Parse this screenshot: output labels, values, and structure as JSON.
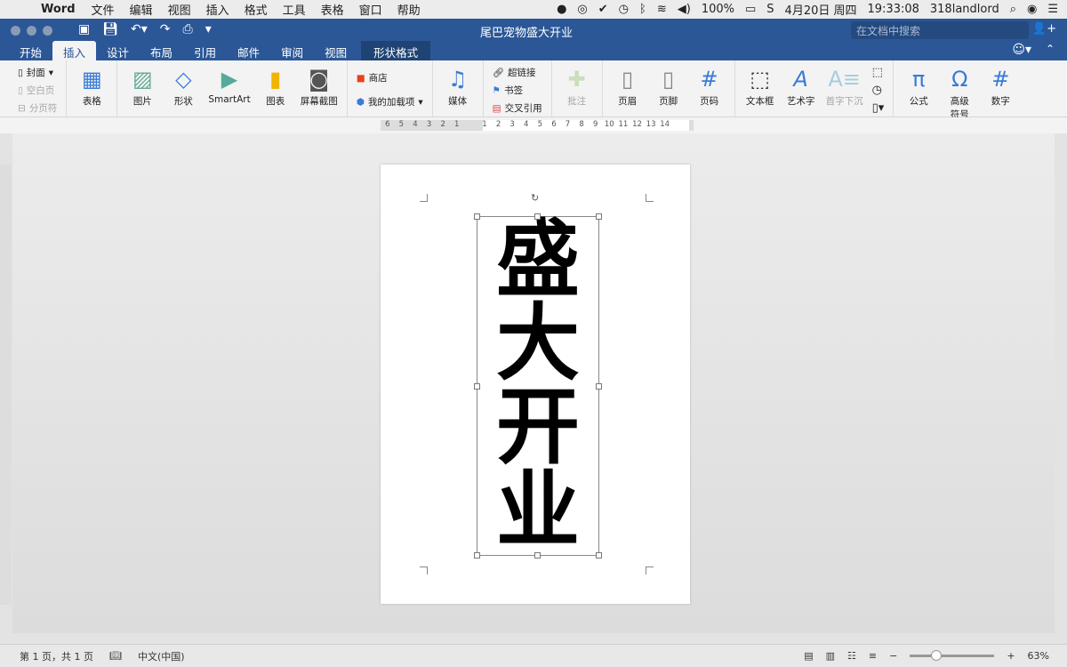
{
  "menubar": {
    "app": "Word",
    "items": [
      "文件",
      "编辑",
      "视图",
      "插入",
      "格式",
      "工具",
      "表格",
      "窗口",
      "帮助"
    ],
    "battery": "100%",
    "date": "4月20日 周四",
    "time": "19:33:08",
    "user": "318landlord"
  },
  "window": {
    "title": "尾巴宠物盛大开业",
    "search_placeholder": "在文档中搜索"
  },
  "tabs": [
    "开始",
    "插入",
    "设计",
    "布局",
    "引用",
    "邮件",
    "审阅",
    "视图"
  ],
  "context_tab": "形状格式",
  "ribbon": {
    "pages": [
      "封面",
      "空白页",
      "分页符"
    ],
    "table": "表格",
    "illustrations": [
      "图片",
      "形状",
      "SmartArt",
      "图表",
      "屏幕截图"
    ],
    "addins": [
      "商店",
      "我的加载项"
    ],
    "media": "媒体",
    "links": [
      "超链接",
      "书签",
      "交叉引用"
    ],
    "comment": "批注",
    "header_footer": [
      "页眉",
      "页脚",
      "页码"
    ],
    "text": [
      "文本框",
      "艺术字",
      "首字下沉"
    ],
    "symbols": [
      "公式",
      "高级符号",
      "数字"
    ]
  },
  "ruler": {
    "left": [
      "6",
      "5",
      "4",
      "3",
      "2",
      "1"
    ],
    "right": [
      "1",
      "2",
      "3",
      "4",
      "5",
      "6",
      "7",
      "8",
      "9",
      "10",
      "11",
      "12",
      "13",
      "14"
    ]
  },
  "document": {
    "text_chars": [
      "盛",
      "大",
      "开",
      "业"
    ]
  },
  "status": {
    "page": "第 1 页，共 1 页",
    "language": "中文(中国)",
    "zoom": "63%",
    "zoom_level": 63
  },
  "colors": {
    "titlebar": "#2b5797",
    "accent": "#3a7bd5"
  }
}
